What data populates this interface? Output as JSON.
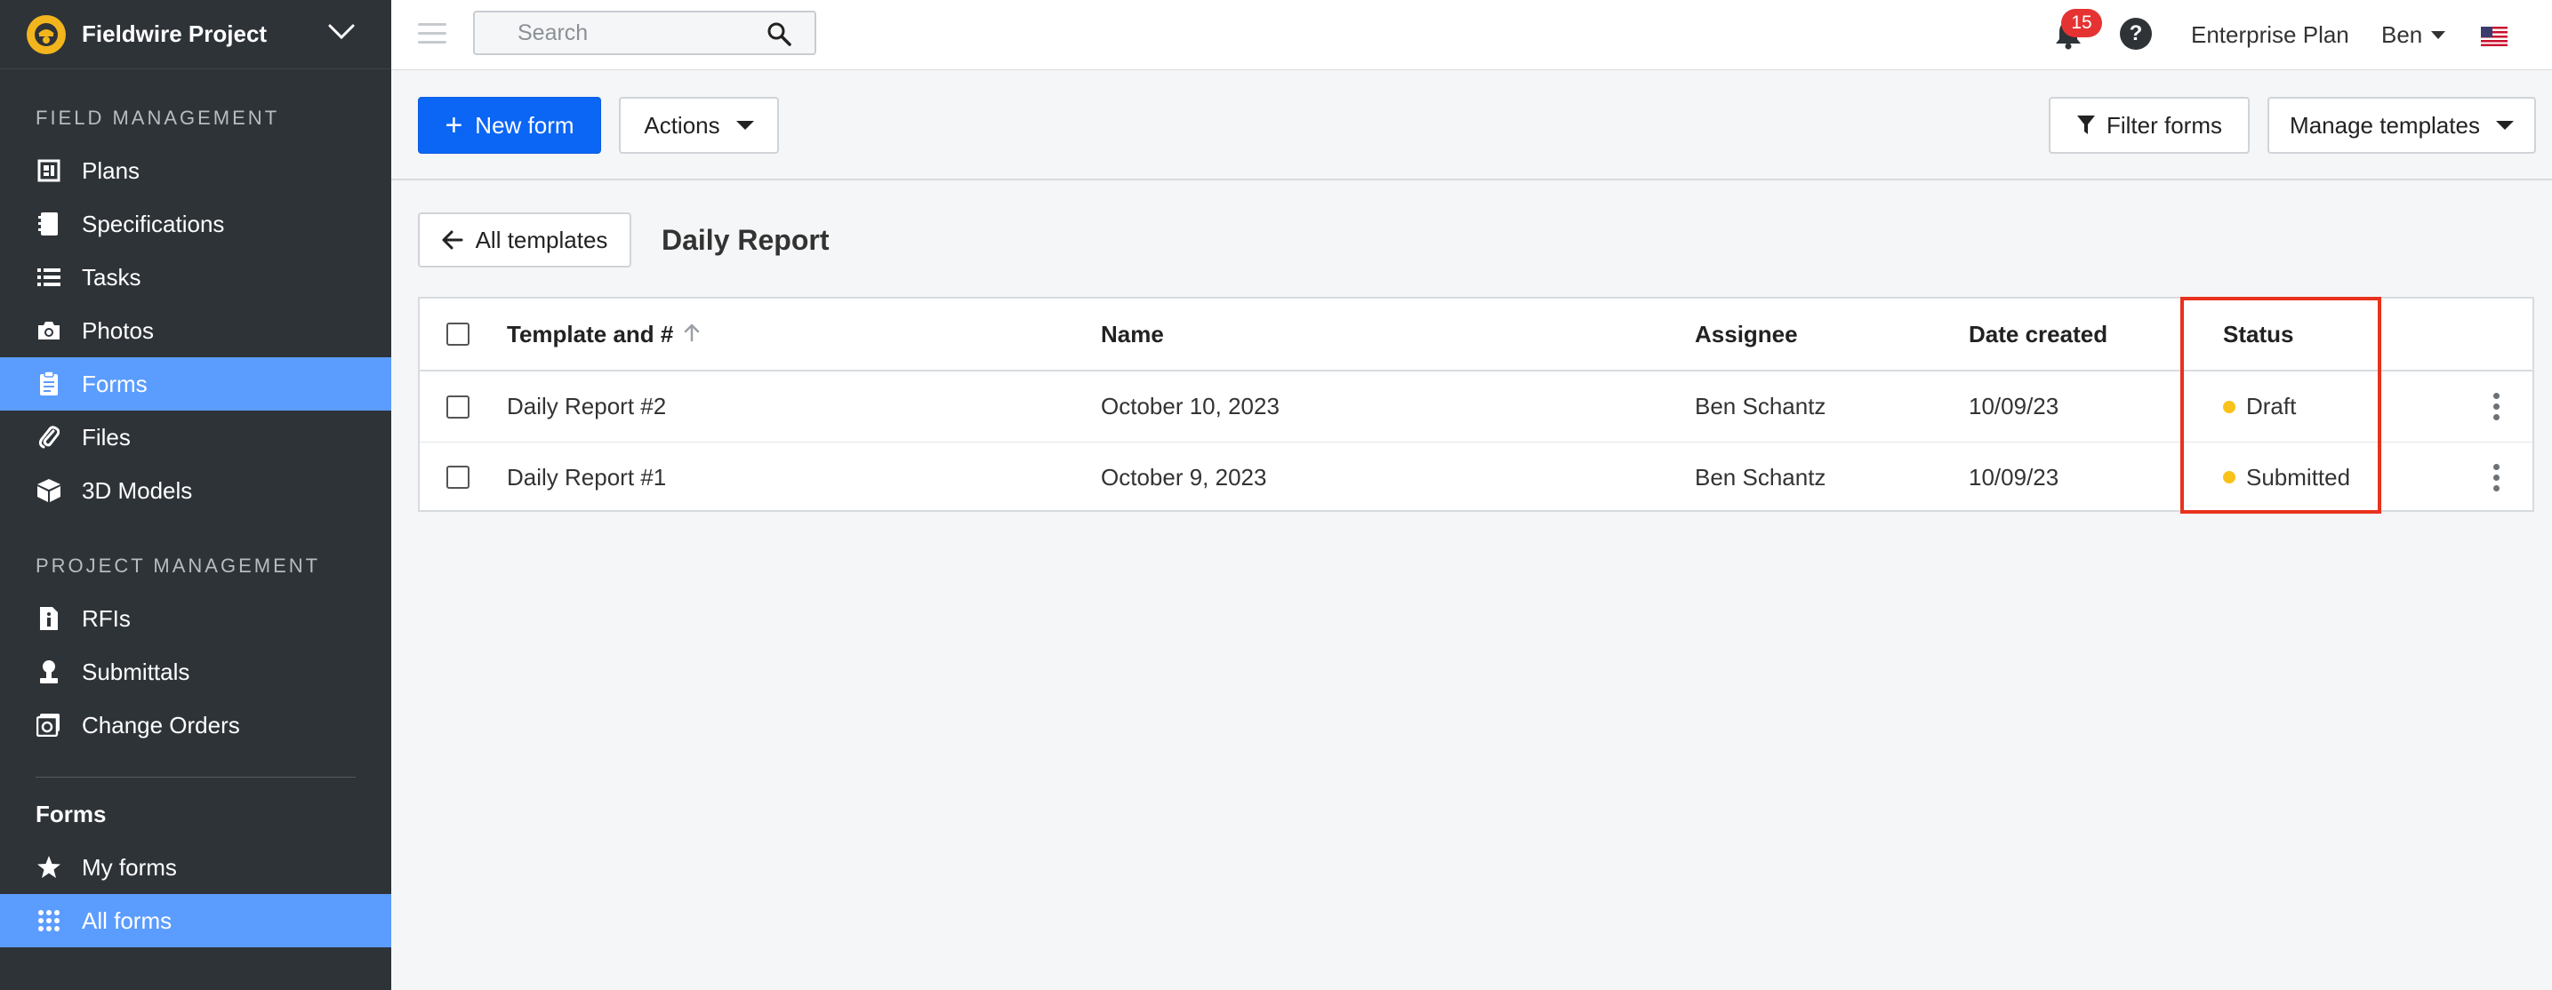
{
  "sidebar": {
    "project_name": "Fieldwire Project",
    "field_management_label": "FIELD MANAGEMENT",
    "field_items": [
      {
        "label": "Plans",
        "icon": "plans-icon"
      },
      {
        "label": "Specifications",
        "icon": "specifications-icon"
      },
      {
        "label": "Tasks",
        "icon": "tasks-icon"
      },
      {
        "label": "Photos",
        "icon": "camera-icon"
      },
      {
        "label": "Forms",
        "icon": "clipboard-icon",
        "active": true
      },
      {
        "label": "Files",
        "icon": "paperclip-icon"
      },
      {
        "label": "3D Models",
        "icon": "cube-icon"
      }
    ],
    "project_management_label": "PROJECT MANAGEMENT",
    "project_items": [
      {
        "label": "RFIs",
        "icon": "rfi-icon"
      },
      {
        "label": "Submittals",
        "icon": "submittals-icon"
      },
      {
        "label": "Change Orders",
        "icon": "change-orders-icon"
      }
    ],
    "forms_title": "Forms",
    "forms_items": [
      {
        "label": "My forms",
        "icon": "star-icon"
      },
      {
        "label": "All forms",
        "icon": "grid-icon",
        "active": true
      }
    ]
  },
  "topbar": {
    "search_placeholder": "Search",
    "notification_count": "15",
    "help_label": "?",
    "plan_label": "Enterprise Plan",
    "user_name": "Ben"
  },
  "actionbar": {
    "new_form_label": "New form",
    "actions_label": "Actions",
    "filter_label": "Filter forms",
    "manage_label": "Manage templates"
  },
  "subheader": {
    "back_label": "All templates",
    "title": "Daily Report"
  },
  "table": {
    "columns": [
      "Template and #",
      "Name",
      "Assignee",
      "Date created",
      "Status"
    ],
    "rows": [
      {
        "template": "Daily Report #2",
        "name": "October 10, 2023",
        "assignee": "Ben Schantz",
        "date": "10/09/23",
        "status": "Draft"
      },
      {
        "template": "Daily Report #1",
        "name": "October 9, 2023",
        "assignee": "Ben Schantz",
        "date": "10/09/23",
        "status": "Submitted"
      }
    ]
  },
  "colors": {
    "sidebar_bg": "#2e3338",
    "active_item": "#5b9cff",
    "primary_button": "#0b66f5",
    "status_dot": "#f8c21b",
    "highlight": "#e8321d",
    "badge": "#e53333"
  }
}
